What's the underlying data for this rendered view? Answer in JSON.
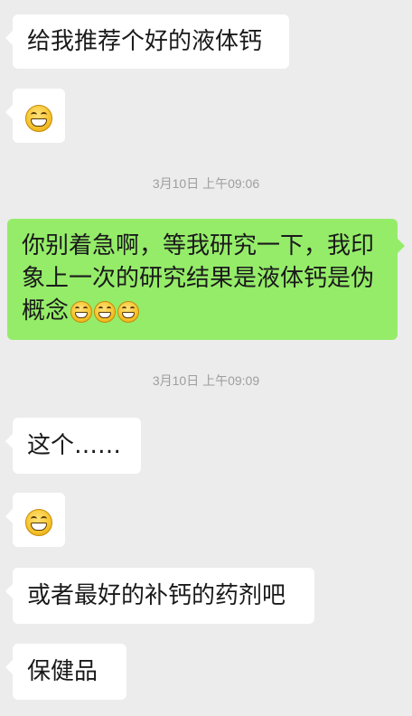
{
  "chat": {
    "messages": [
      {
        "side": "left",
        "text": "给我推荐个好的液体钙"
      },
      {
        "side": "left",
        "emoji": "grinning-face-icon"
      },
      {
        "side": "right",
        "text_line1": "你别着急啊，等我研究一下，我印",
        "text_line2": "象上一次的研究结果是液体钙是伪",
        "text_line3": "概念",
        "emojis": [
          "laughing-face-icon",
          "laughing-face-icon",
          "laughing-face-icon"
        ]
      },
      {
        "side": "left",
        "text": "这个……"
      },
      {
        "side": "left",
        "emoji": "grinning-face-icon"
      },
      {
        "side": "left",
        "text": "或者最好的补钙的药剂吧"
      },
      {
        "side": "left",
        "text": "保健品"
      }
    ],
    "timestamps": [
      "3月10日 上午09:06",
      "3月10日 上午09:09"
    ]
  },
  "colors": {
    "background": "#ececec",
    "incoming_bubble": "#ffffff",
    "outgoing_bubble": "#95ec69",
    "timestamp_text": "#9e9e9e"
  }
}
